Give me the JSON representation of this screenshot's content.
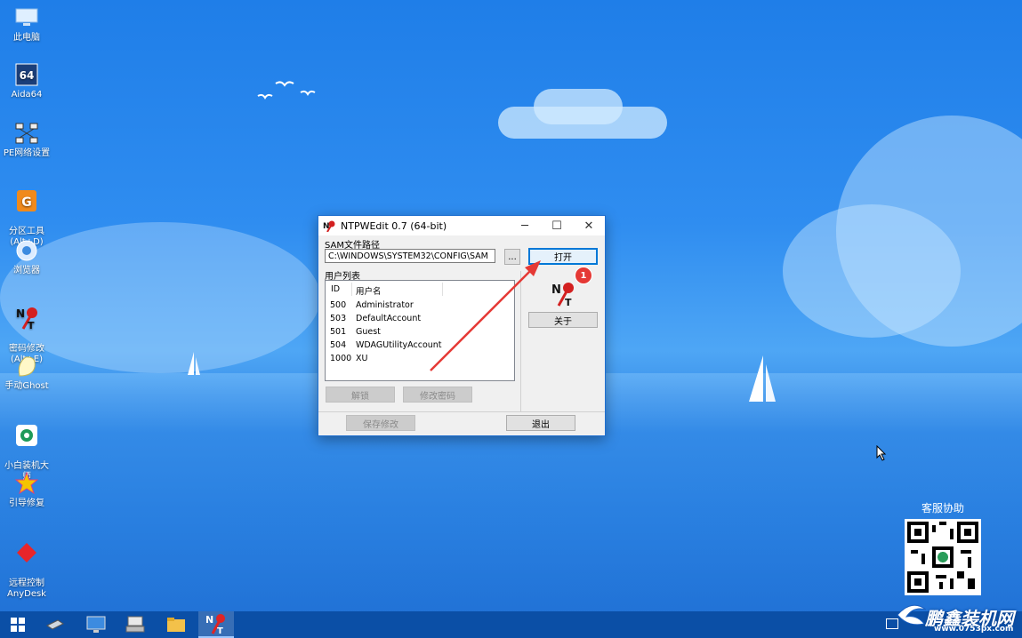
{
  "desktop": {
    "icons": [
      {
        "label": "此电脑",
        "icon": "computer-icon"
      },
      {
        "label": "Aida64",
        "icon": "aida64-icon"
      },
      {
        "label": "PE网络设置",
        "icon": "network-icon"
      },
      {
        "label": "分区工具\n(Alt+D)",
        "icon": "partition-tool-icon"
      },
      {
        "label": "浏览器",
        "icon": "browser-icon"
      },
      {
        "label": "密码修改\n(Alt+E)",
        "icon": "password-tool-icon"
      },
      {
        "label": "手动Ghost",
        "icon": "ghost-icon"
      },
      {
        "label": "小白装机大\n师",
        "icon": "installer-icon"
      },
      {
        "label": "引导修复",
        "icon": "boot-repair-icon"
      },
      {
        "label": "远程控制\nAnyDesk",
        "icon": "anydesk-icon"
      }
    ]
  },
  "window": {
    "title": "NTPWEdit 0.7 (64-bit)",
    "sam_label": "SAM文件路径",
    "sam_path": "C:\\WINDOWS\\SYSTEM32\\CONFIG\\SAM",
    "browse_label": "...",
    "open_label": "打开",
    "about_label": "关于",
    "users_label": "用户列表",
    "columns": {
      "id": "ID",
      "name": "用户名"
    },
    "users": [
      {
        "id": "500",
        "name": "Administrator"
      },
      {
        "id": "503",
        "name": "DefaultAccount"
      },
      {
        "id": "501",
        "name": "Guest"
      },
      {
        "id": "504",
        "name": "WDAGUtilityAccount"
      },
      {
        "id": "1000",
        "name": "XU"
      }
    ],
    "unlock_label": "解锁",
    "change_pw_label": "修改密码",
    "save_label": "保存修改",
    "exit_label": "退出",
    "step_badge": "1"
  },
  "qr": {
    "title": "客服协助"
  },
  "watermark": {
    "brand": "鹏鑫装机网",
    "url": "www.0753px.com"
  },
  "colors": {
    "accent": "#0078d7",
    "badge": "#e53935",
    "arrow": "#e53935"
  }
}
